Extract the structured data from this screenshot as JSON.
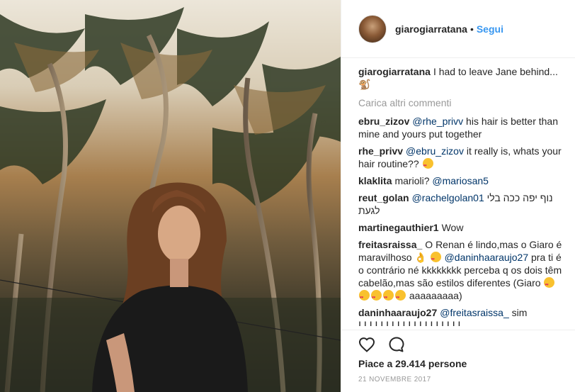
{
  "header": {
    "username": "giarogiarratana",
    "separator": "•",
    "follow_label": "Segui"
  },
  "caption": {
    "username": "giarogiarratana",
    "text": "I had to leave Jane behind..."
  },
  "load_more_label": "Carica altri commenti",
  "comments": [
    {
      "username": "ebru_zizov",
      "mention": "@rhe_privv",
      "text": "his hair is better than mine and yours put together",
      "emoji": ""
    },
    {
      "username": "rhe_privv",
      "mention": "@ebru_zizov",
      "text": "it really is, whats your hair routine??",
      "emoji": "heart-eyes"
    },
    {
      "username": "klaklita",
      "text_before": "marioli?",
      "mention": "@mariosan5",
      "text": ""
    },
    {
      "username": "reut_golan",
      "mention": "@rachelgolan01",
      "text": "נוף יפה ככה בלי לגעת"
    },
    {
      "username": "martinegauthier1",
      "text": "Wow"
    },
    {
      "username": "freitasraissa_",
      "text_a": "O Renan é lindo,mas o Giaro é maravilhoso",
      "mention": "@daninhaaraujo27",
      "text_b": "pra ti é o contrário né kkkkkkkk perceba q os dois têm cabelão,mas são estilos diferentes (Giaro",
      "text_c": "aaaaaaaaa)"
    },
    {
      "username": "daninhaaraujo27",
      "mention": "@freitasraissa_",
      "text": "sim",
      "text2": "ᒪᒪᒪᒪᒪᒪᒪᒪᒪᒪᒪᒪᒪᒪᒪᒪᒪᒪᒪ"
    }
  ],
  "likes_label": "Piace a 29.414 persone",
  "date_label": "21 NOVEMBRE 2017",
  "icons": {
    "like": "heart-outline-icon",
    "comment": "comment-bubble-icon"
  },
  "colors": {
    "link": "#3897f0",
    "mention": "#003569",
    "muted": "#999999",
    "text": "#262626"
  }
}
